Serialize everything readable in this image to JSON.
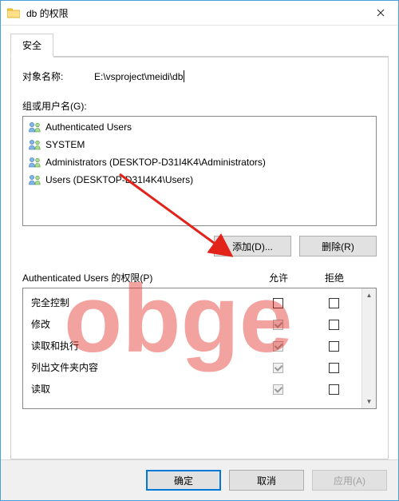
{
  "window": {
    "title": "db 的权限"
  },
  "tab": {
    "security": "安全"
  },
  "object": {
    "label": "对象名称:",
    "path": "E:\\vsproject\\meidi\\db"
  },
  "groups": {
    "label": "组或用户名(G):",
    "items": [
      "Authenticated Users",
      "SYSTEM",
      "Administrators (DESKTOP-D31I4K4\\Administrators)",
      "Users (DESKTOP-D31I4K4\\Users)"
    ]
  },
  "buttons": {
    "add": "添加(D)...",
    "remove": "删除(R)",
    "ok": "确定",
    "cancel": "取消",
    "apply": "应用(A)"
  },
  "perm": {
    "header": "Authenticated Users 的权限(P)",
    "col_allow": "允许",
    "col_deny": "拒绝",
    "rows": [
      {
        "name": "完全控制",
        "allow": false,
        "deny": false,
        "allow_disabled": false
      },
      {
        "name": "修改",
        "allow": true,
        "deny": false,
        "allow_disabled": true
      },
      {
        "name": "读取和执行",
        "allow": true,
        "deny": false,
        "allow_disabled": true
      },
      {
        "name": "列出文件夹内容",
        "allow": true,
        "deny": false,
        "allow_disabled": true
      },
      {
        "name": "读取",
        "allow": true,
        "deny": false,
        "allow_disabled": true
      }
    ]
  },
  "watermark_text": "obge"
}
